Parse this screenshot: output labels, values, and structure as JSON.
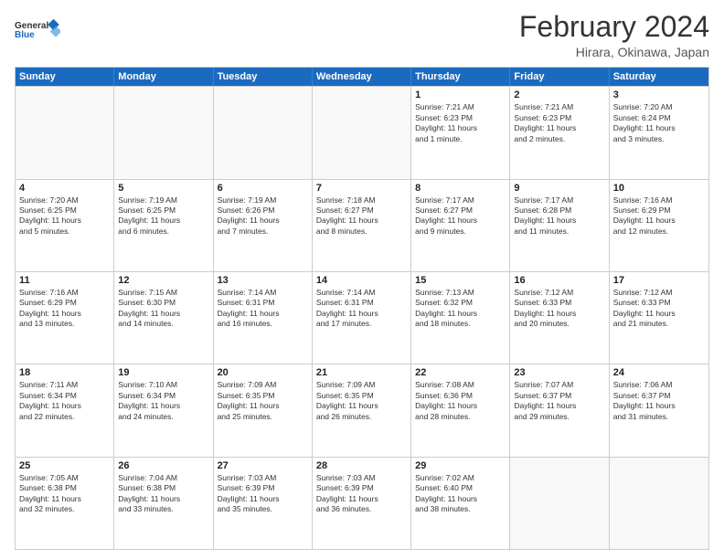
{
  "logo": {
    "general": "General",
    "blue": "Blue"
  },
  "title": "February 2024",
  "subtitle": "Hirara, Okinawa, Japan",
  "headers": [
    "Sunday",
    "Monday",
    "Tuesday",
    "Wednesday",
    "Thursday",
    "Friday",
    "Saturday"
  ],
  "rows": [
    [
      {
        "day": "",
        "info": "",
        "empty": true
      },
      {
        "day": "",
        "info": "",
        "empty": true
      },
      {
        "day": "",
        "info": "",
        "empty": true
      },
      {
        "day": "",
        "info": "",
        "empty": true
      },
      {
        "day": "1",
        "info": "Sunrise: 7:21 AM\nSunset: 6:23 PM\nDaylight: 11 hours\nand 1 minute."
      },
      {
        "day": "2",
        "info": "Sunrise: 7:21 AM\nSunset: 6:23 PM\nDaylight: 11 hours\nand 2 minutes."
      },
      {
        "day": "3",
        "info": "Sunrise: 7:20 AM\nSunset: 6:24 PM\nDaylight: 11 hours\nand 3 minutes."
      }
    ],
    [
      {
        "day": "4",
        "info": "Sunrise: 7:20 AM\nSunset: 6:25 PM\nDaylight: 11 hours\nand 5 minutes."
      },
      {
        "day": "5",
        "info": "Sunrise: 7:19 AM\nSunset: 6:25 PM\nDaylight: 11 hours\nand 6 minutes."
      },
      {
        "day": "6",
        "info": "Sunrise: 7:19 AM\nSunset: 6:26 PM\nDaylight: 11 hours\nand 7 minutes."
      },
      {
        "day": "7",
        "info": "Sunrise: 7:18 AM\nSunset: 6:27 PM\nDaylight: 11 hours\nand 8 minutes."
      },
      {
        "day": "8",
        "info": "Sunrise: 7:17 AM\nSunset: 6:27 PM\nDaylight: 11 hours\nand 9 minutes."
      },
      {
        "day": "9",
        "info": "Sunrise: 7:17 AM\nSunset: 6:28 PM\nDaylight: 11 hours\nand 11 minutes."
      },
      {
        "day": "10",
        "info": "Sunrise: 7:16 AM\nSunset: 6:29 PM\nDaylight: 11 hours\nand 12 minutes."
      }
    ],
    [
      {
        "day": "11",
        "info": "Sunrise: 7:16 AM\nSunset: 6:29 PM\nDaylight: 11 hours\nand 13 minutes."
      },
      {
        "day": "12",
        "info": "Sunrise: 7:15 AM\nSunset: 6:30 PM\nDaylight: 11 hours\nand 14 minutes."
      },
      {
        "day": "13",
        "info": "Sunrise: 7:14 AM\nSunset: 6:31 PM\nDaylight: 11 hours\nand 16 minutes."
      },
      {
        "day": "14",
        "info": "Sunrise: 7:14 AM\nSunset: 6:31 PM\nDaylight: 11 hours\nand 17 minutes."
      },
      {
        "day": "15",
        "info": "Sunrise: 7:13 AM\nSunset: 6:32 PM\nDaylight: 11 hours\nand 18 minutes."
      },
      {
        "day": "16",
        "info": "Sunrise: 7:12 AM\nSunset: 6:33 PM\nDaylight: 11 hours\nand 20 minutes."
      },
      {
        "day": "17",
        "info": "Sunrise: 7:12 AM\nSunset: 6:33 PM\nDaylight: 11 hours\nand 21 minutes."
      }
    ],
    [
      {
        "day": "18",
        "info": "Sunrise: 7:11 AM\nSunset: 6:34 PM\nDaylight: 11 hours\nand 22 minutes."
      },
      {
        "day": "19",
        "info": "Sunrise: 7:10 AM\nSunset: 6:34 PM\nDaylight: 11 hours\nand 24 minutes."
      },
      {
        "day": "20",
        "info": "Sunrise: 7:09 AM\nSunset: 6:35 PM\nDaylight: 11 hours\nand 25 minutes."
      },
      {
        "day": "21",
        "info": "Sunrise: 7:09 AM\nSunset: 6:35 PM\nDaylight: 11 hours\nand 26 minutes."
      },
      {
        "day": "22",
        "info": "Sunrise: 7:08 AM\nSunset: 6:36 PM\nDaylight: 11 hours\nand 28 minutes."
      },
      {
        "day": "23",
        "info": "Sunrise: 7:07 AM\nSunset: 6:37 PM\nDaylight: 11 hours\nand 29 minutes."
      },
      {
        "day": "24",
        "info": "Sunrise: 7:06 AM\nSunset: 6:37 PM\nDaylight: 11 hours\nand 31 minutes."
      }
    ],
    [
      {
        "day": "25",
        "info": "Sunrise: 7:05 AM\nSunset: 6:38 PM\nDaylight: 11 hours\nand 32 minutes."
      },
      {
        "day": "26",
        "info": "Sunrise: 7:04 AM\nSunset: 6:38 PM\nDaylight: 11 hours\nand 33 minutes."
      },
      {
        "day": "27",
        "info": "Sunrise: 7:03 AM\nSunset: 6:39 PM\nDaylight: 11 hours\nand 35 minutes."
      },
      {
        "day": "28",
        "info": "Sunrise: 7:03 AM\nSunset: 6:39 PM\nDaylight: 11 hours\nand 36 minutes."
      },
      {
        "day": "29",
        "info": "Sunrise: 7:02 AM\nSunset: 6:40 PM\nDaylight: 11 hours\nand 38 minutes."
      },
      {
        "day": "",
        "info": "",
        "empty": true
      },
      {
        "day": "",
        "info": "",
        "empty": true
      }
    ]
  ]
}
